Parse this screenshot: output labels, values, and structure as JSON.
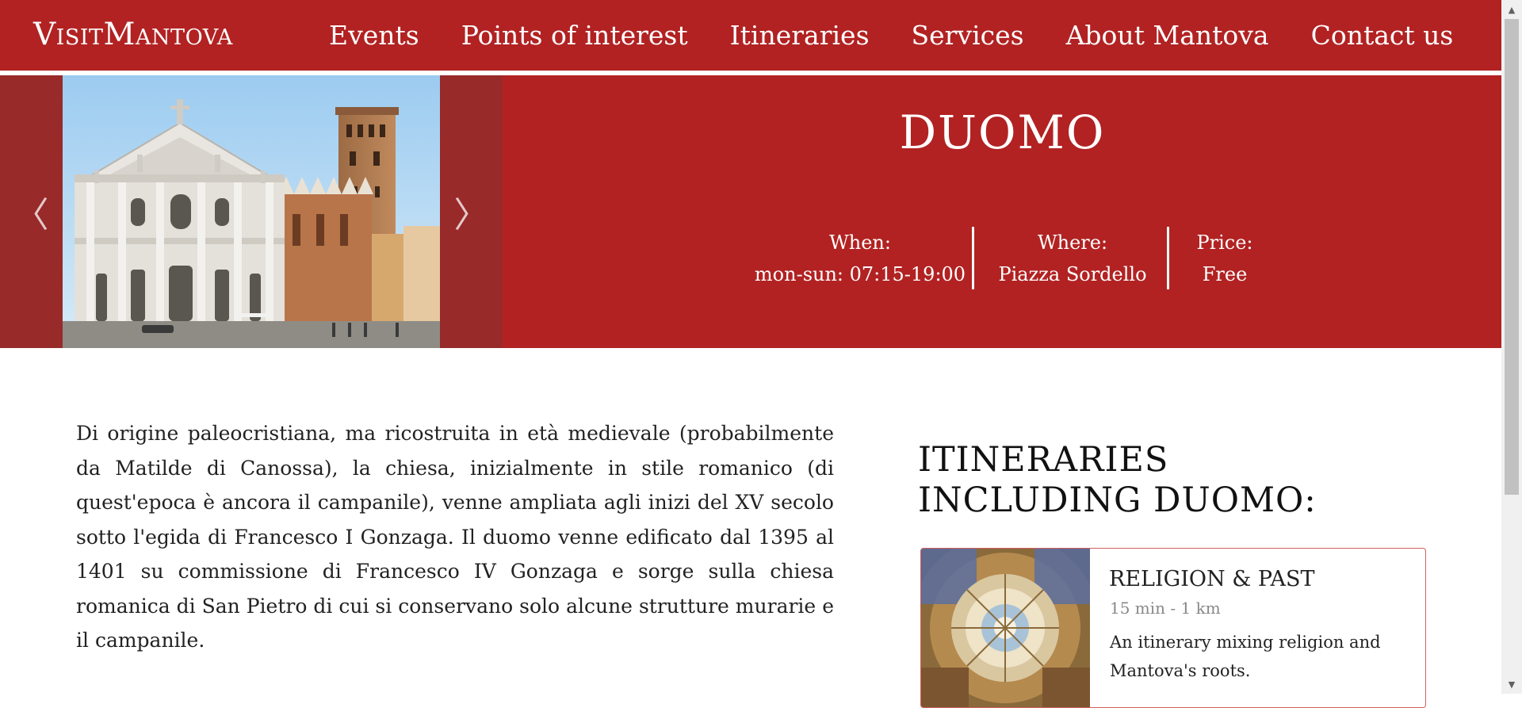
{
  "site": {
    "logo": "VisitMantova"
  },
  "nav": {
    "items": [
      "Events",
      "Points of interest",
      "Itineraries",
      "Services",
      "About Mantova",
      "Contact us"
    ]
  },
  "carousel": {
    "prev_icon": "chevron-left-icon",
    "next_icon": "chevron-right-icon",
    "prev_glyph": "〈",
    "next_glyph": "〉"
  },
  "hero": {
    "title": "DUOMO",
    "when_label": "When:",
    "when_value": "mon-sun: 07:15-19:00",
    "where_label": "Where:",
    "where_value": "Piazza Sordello",
    "price_label": "Price:",
    "price_value": "Free"
  },
  "description": "Di origine paleocristiana, ma ricostruita in età medievale (probabilmente da Matilde di Canossa), la chiesa, inizialmente in stile romanico (di quest'epoca è ancora il campanile), venne ampliata agli inizi del XV secolo sotto l'egida di Francesco I Gonzaga. Il duomo venne edificato dal 1395 al 1401 su commissione di Francesco IV Gonzaga e sorge sulla chiesa romanica di San Pietro di cui si conservano solo alcune strutture murarie e il campanile.",
  "itineraries": {
    "heading": "ITINERARIES INCLUDING DUOMO:",
    "cards": [
      {
        "title": "RELIGION & PAST",
        "meta": "15 min - 1 km",
        "text": "An itinerary mixing religion and Mantova's roots."
      }
    ]
  },
  "colors": {
    "brand": "#b22222",
    "carousel_bg": "#982a2a",
    "card_border": "#d06060"
  },
  "scrollbar": {
    "up_glyph": "▲",
    "down_glyph": "▼"
  }
}
